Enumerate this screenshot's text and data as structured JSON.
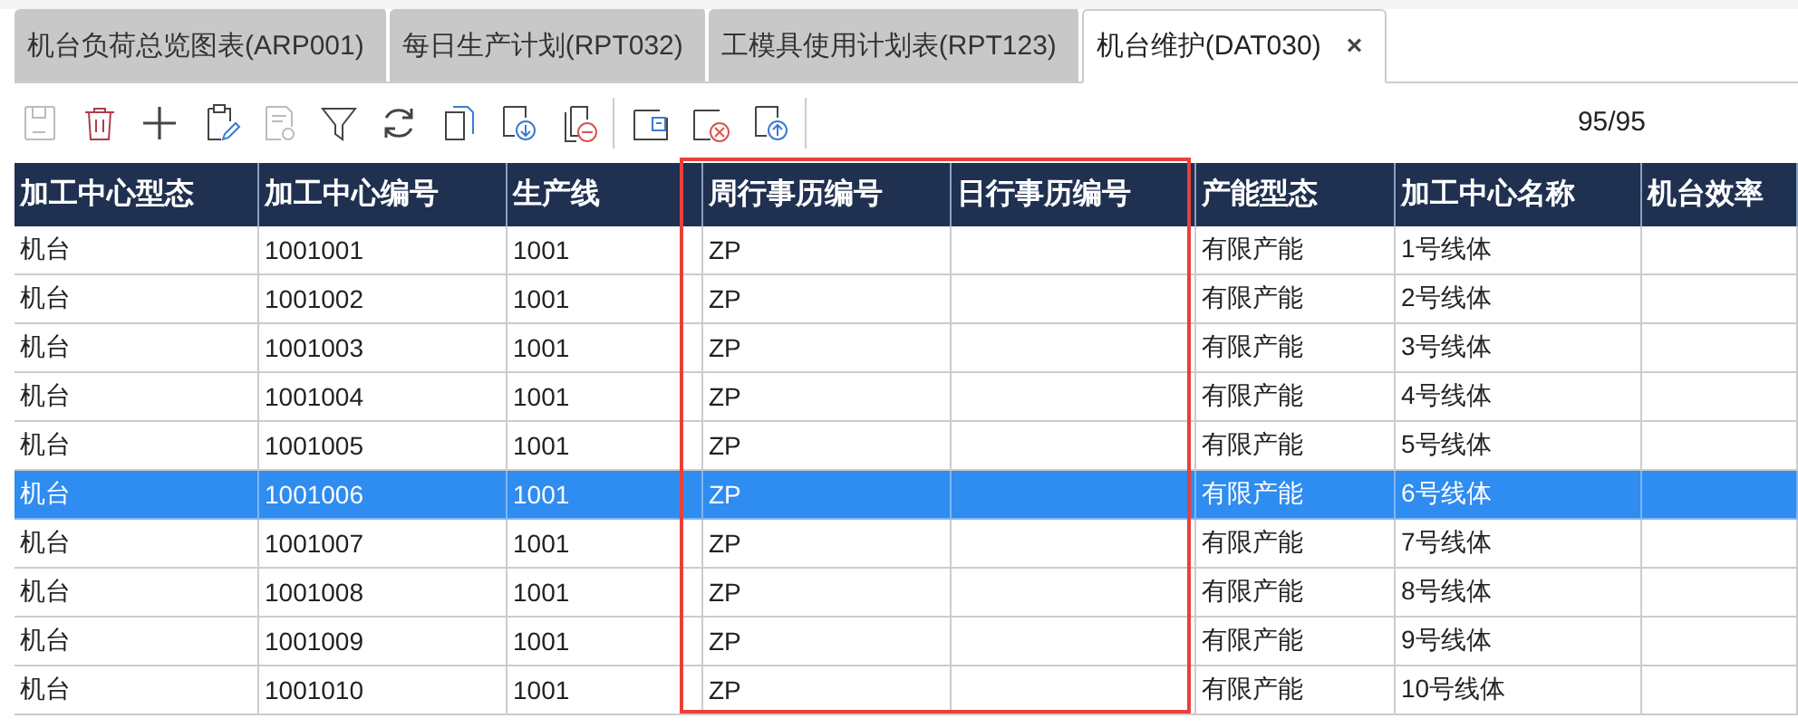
{
  "tabs": [
    {
      "label": "机台负荷总览图表(ARP001)",
      "selected": false
    },
    {
      "label": "每日生产计划(RPT032)",
      "selected": false
    },
    {
      "label": "工模具使用计划表(RPT123)",
      "selected": false
    },
    {
      "label": "机台维护(DAT030)",
      "selected": true,
      "close": "×"
    }
  ],
  "toolbar": [
    {
      "kind": "save",
      "disabled": true
    },
    {
      "kind": "delete",
      "disabled": false
    },
    {
      "kind": "add",
      "disabled": false
    },
    {
      "kind": "edit",
      "disabled": false
    },
    {
      "kind": "query",
      "disabled": true
    },
    {
      "kind": "filter",
      "disabled": false
    },
    {
      "kind": "refresh",
      "disabled": false
    },
    {
      "kind": "copy",
      "disabled": false
    },
    {
      "kind": "import",
      "disabled": false
    },
    {
      "kind": "remove",
      "disabled": false
    },
    {
      "kind": "separator"
    },
    {
      "kind": "export",
      "disabled": false
    },
    {
      "kind": "cancel",
      "disabled": false
    },
    {
      "kind": "upload",
      "disabled": false
    },
    {
      "kind": "separator"
    }
  ],
  "record_count": "95/95",
  "table": {
    "columns": [
      {
        "label": "加工中心型态",
        "highlighted": false
      },
      {
        "label": "加工中心编号",
        "highlighted": false
      },
      {
        "label": "生产线",
        "highlighted": false
      },
      {
        "label": "周行事历编号",
        "highlighted": true
      },
      {
        "label": "日行事历编号",
        "highlighted": true
      },
      {
        "label": "产能型态",
        "highlighted": false
      },
      {
        "label": "加工中心名称",
        "highlighted": false
      },
      {
        "label": "机台效率",
        "highlighted": false
      }
    ],
    "rows": [
      {
        "selected": false,
        "cells": [
          "机台",
          "1001001",
          "1001",
          "ZP",
          "",
          "有限产能",
          "1号线体",
          ""
        ]
      },
      {
        "selected": false,
        "cells": [
          "机台",
          "1001002",
          "1001",
          "ZP",
          "",
          "有限产能",
          "2号线体",
          ""
        ]
      },
      {
        "selected": false,
        "cells": [
          "机台",
          "1001003",
          "1001",
          "ZP",
          "",
          "有限产能",
          "3号线体",
          ""
        ]
      },
      {
        "selected": false,
        "cells": [
          "机台",
          "1001004",
          "1001",
          "ZP",
          "",
          "有限产能",
          "4号线体",
          ""
        ]
      },
      {
        "selected": false,
        "cells": [
          "机台",
          "1001005",
          "1001",
          "ZP",
          "",
          "有限产能",
          "5号线体",
          ""
        ]
      },
      {
        "selected": true,
        "cells": [
          "机台",
          "1001006",
          "1001",
          "ZP",
          "",
          "有限产能",
          "6号线体",
          ""
        ]
      },
      {
        "selected": false,
        "cells": [
          "机台",
          "1001007",
          "1001",
          "ZP",
          "",
          "有限产能",
          "7号线体",
          ""
        ]
      },
      {
        "selected": false,
        "cells": [
          "机台",
          "1001008",
          "1001",
          "ZP",
          "",
          "有限产能",
          "8号线体",
          ""
        ]
      },
      {
        "selected": false,
        "cells": [
          "机台",
          "1001009",
          "1001",
          "ZP",
          "",
          "有限产能",
          "9号线体",
          ""
        ]
      },
      {
        "selected": false,
        "cells": [
          "机台",
          "1001010",
          "1001",
          "ZP",
          "",
          "有限产能",
          "10号线体",
          ""
        ]
      }
    ]
  }
}
